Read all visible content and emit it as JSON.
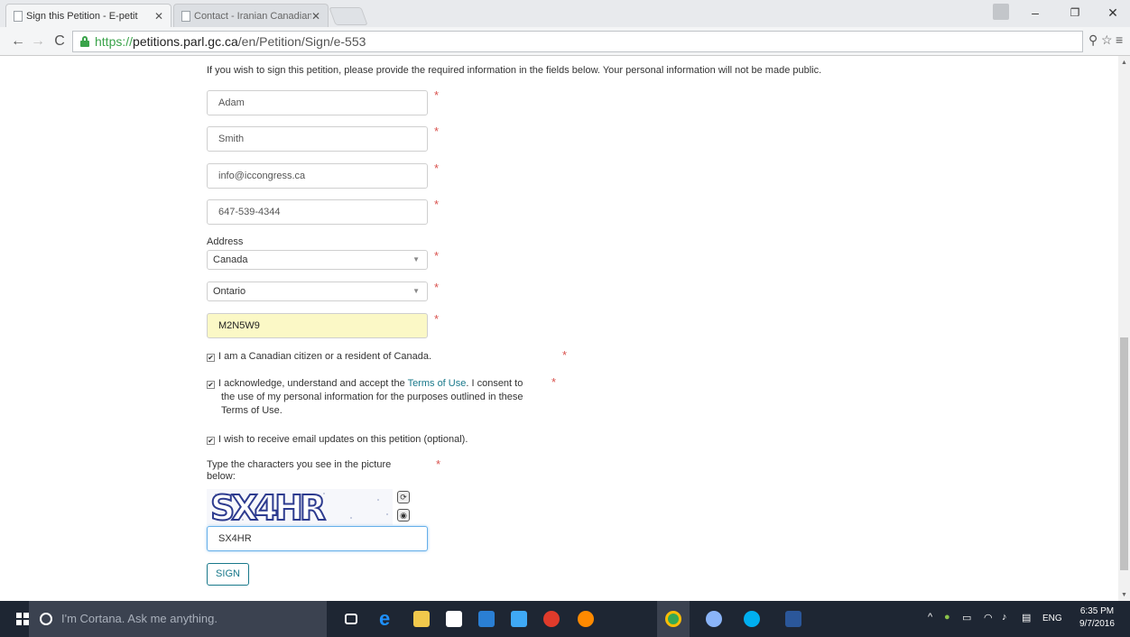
{
  "browser": {
    "tabs": [
      {
        "label": "Sign this Petition - E-petit",
        "active": true
      },
      {
        "label": "Contact - Iranian Canadian",
        "active": false
      }
    ],
    "url": {
      "scheme": "https://",
      "host": "petitions.parl.gc.ca",
      "path": "/en/Petition/Sign/e-553"
    },
    "window_controls": {
      "minimize": "–",
      "restore": "❐",
      "close": "✕"
    }
  },
  "form": {
    "intro": "If you wish to sign this petition, please provide the required information in the fields below. Your personal information will not be made public.",
    "first_name": "Adam",
    "last_name": "Smith",
    "email": "info@iccongress.ca",
    "phone": "647-539-4344",
    "address_label": "Address",
    "country": "Canada",
    "province": "Ontario",
    "postal_code": "M2N5W9",
    "required_marker": "*",
    "checkbox_residency": "I am a Canadian citizen or a resident of Canada.",
    "terms_prefix": "I acknowledge, understand and accept the ",
    "terms_link": "Terms of Use",
    "terms_suffix_line1": ". I consent to",
    "terms_suffix_line2": "the use of my personal information for the purposes outlined in these",
    "terms_suffix_line3": "Terms of Use.",
    "checkbox_updates": "I wish to receive email updates on this petition (optional).",
    "captcha_label_line1": "Type the characters you see in the picture",
    "captcha_label_line2": "below:",
    "captcha_text": "SX4HR",
    "captcha_input": "SX4HR",
    "sign_button": "SIGN"
  },
  "taskbar": {
    "cortana_placeholder": "I'm Cortana. Ask me anything.",
    "language": "ENG",
    "time": "6:35 PM",
    "date": "9/7/2016"
  },
  "colors": {
    "link": "#18788a",
    "required": "#d9534f",
    "autofill": "#fbf8c6",
    "secure": "#3aa34a"
  }
}
